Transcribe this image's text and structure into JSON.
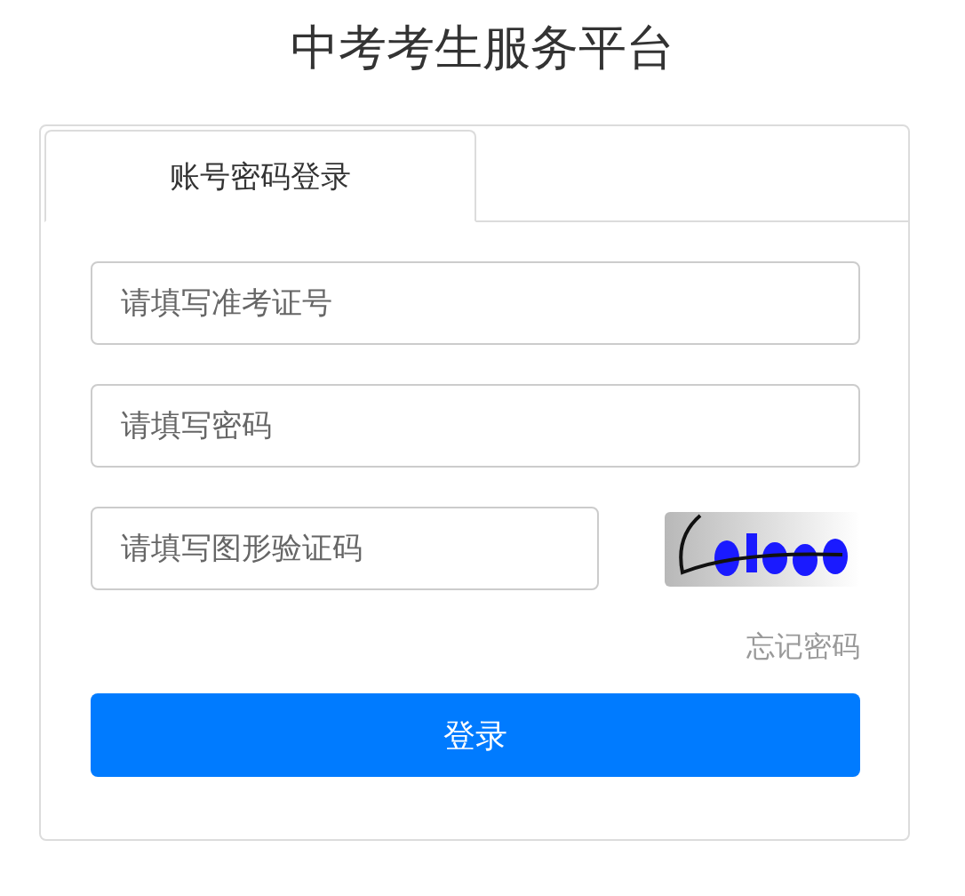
{
  "title": "中考考生服务平台",
  "tabs": [
    {
      "label": "账号密码登录",
      "selected": true
    }
  ],
  "fields": [
    {
      "placeholder": "请填写准考证号"
    },
    {
      "placeholder": "请填写密码"
    }
  ],
  "captcha": {
    "placeholder": "请填写图形验证码"
  },
  "forgot_link": "忘记密码",
  "submit_button": "登录"
}
